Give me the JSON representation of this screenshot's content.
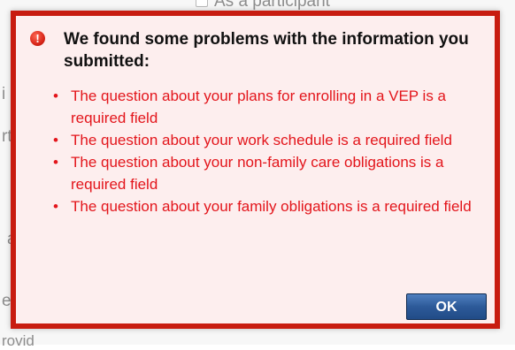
{
  "background": {
    "checkbox_label": "As a participant",
    "fragments": [
      "i",
      "rt",
      "a",
      "e",
      "rovid"
    ]
  },
  "dialog": {
    "icon": "error-warning-icon",
    "icon_glyph": "!",
    "title": "We found some problems with the information you submitted:",
    "errors": [
      "The question about your plans for enrolling in a VEP is a required field",
      "The question about your work schedule is a required field",
      "The question about your non-family care obligations is a required field",
      "The question about your family obligations is a required field"
    ],
    "ok_label": "OK"
  },
  "colors": {
    "dialog_border": "#c81c10",
    "dialog_background": "#fdeeee",
    "error_text": "#e3151b",
    "button": "#2d5a99"
  }
}
